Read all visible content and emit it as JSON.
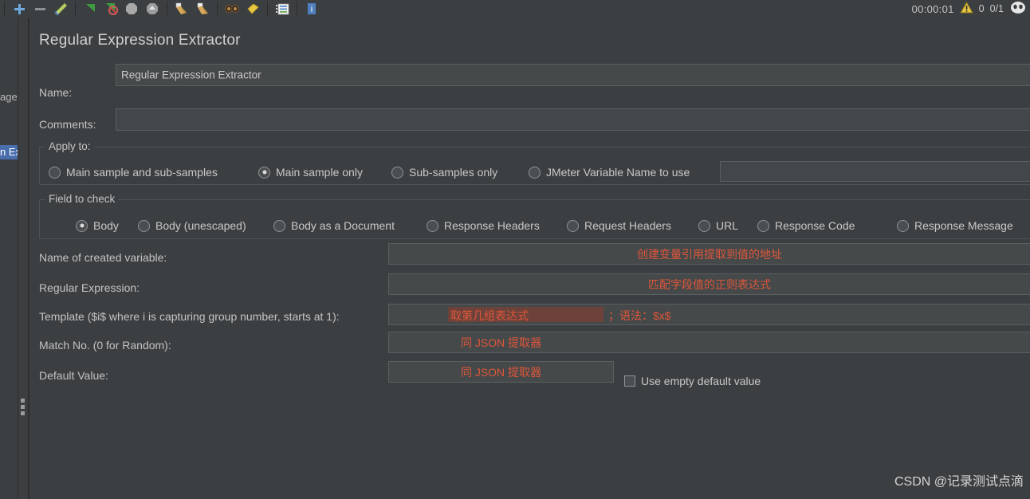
{
  "toolbar": {
    "icons": [
      {
        "name": "add-icon",
        "glyph": "plus"
      },
      {
        "name": "remove-icon",
        "glyph": "minus"
      },
      {
        "name": "edit-pencil-icon",
        "glyph": "pencil"
      },
      {
        "name": "start-icon",
        "glyph": "play"
      },
      {
        "name": "start-no-timers-icon",
        "glyph": "play-no"
      },
      {
        "name": "stop-icon",
        "glyph": "stop"
      },
      {
        "name": "shutdown-icon",
        "glyph": "shutdown"
      },
      {
        "name": "clear-icon",
        "glyph": "broom"
      },
      {
        "name": "clear-all-icon",
        "glyph": "broom-all"
      },
      {
        "name": "search-icon",
        "glyph": "goggles"
      },
      {
        "name": "reset-search-icon",
        "glyph": "yellow-broom"
      },
      {
        "name": "function-helper-icon",
        "glyph": "list"
      },
      {
        "name": "help-icon",
        "glyph": "help"
      }
    ],
    "status": {
      "elapsed_time": "00:00:01",
      "warning_icon": "warning-triangle-icon",
      "warning_count": "0",
      "threads": "0/1",
      "user_icon": "thread-face-icon"
    }
  },
  "tree": {
    "partial_item": "age",
    "selected_item": "n Ex"
  },
  "panel": {
    "title": "Regular Expression Extractor",
    "name_label": "Name:",
    "name_value": "Regular Expression Extractor",
    "comments_label": "Comments:",
    "comments_value": ""
  },
  "apply_to": {
    "group_title": "Apply to:",
    "options": [
      {
        "label": "Main sample and sub-samples",
        "selected": false
      },
      {
        "label": "Main sample only",
        "selected": true
      },
      {
        "label": "Sub-samples only",
        "selected": false
      },
      {
        "label": "JMeter Variable Name to use",
        "selected": false
      }
    ],
    "variable_field_value": ""
  },
  "field_to_check": {
    "group_title": "Field to check",
    "options": [
      {
        "label": "Body",
        "selected": true
      },
      {
        "label": "Body (unescaped)",
        "selected": false
      },
      {
        "label": "Body as a Document",
        "selected": false
      },
      {
        "label": "Response Headers",
        "selected": false
      },
      {
        "label": "Request Headers",
        "selected": false
      },
      {
        "label": "URL",
        "selected": false
      },
      {
        "label": "Response Code",
        "selected": false
      },
      {
        "label": "Response Message",
        "selected": false
      }
    ]
  },
  "fields": {
    "variable_name_label": "Name of created variable:",
    "variable_name_annotation": "创建变量引用提取到值的地址",
    "regex_label": "Regular Expression:",
    "regex_annotation": "匹配字段值的正则表达式",
    "template_label": "Template ($i$ where i is capturing group number, starts at 1):",
    "template_annotation_highlight": "取第几组表达式",
    "template_annotation_rest": "；语法：$x$",
    "match_no_label": "Match No. (0 for Random):",
    "match_no_annotation": "同 JSON 提取器",
    "default_value_label": "Default Value:",
    "default_value_annotation": "同 JSON 提取器",
    "use_empty_default_label": "Use empty default value",
    "use_empty_default_checked": false
  },
  "watermark": "CSDN @记录测试点滴",
  "colors": {
    "background": "#3c3f41",
    "field_background": "#45494a",
    "annotation_red": "#e0563a",
    "selection_blue": "#4b6eaf",
    "text": "#c8c8c8"
  }
}
